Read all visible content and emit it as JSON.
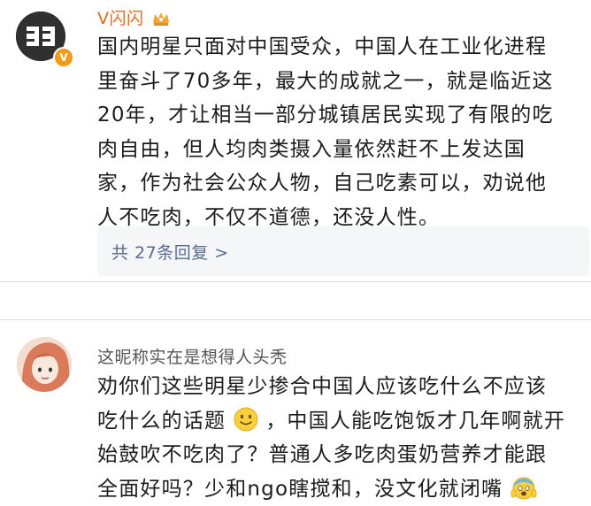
{
  "comments": [
    {
      "username": "V闪闪",
      "username_color": "#e8671c",
      "avatar_text": "ΞΞ",
      "verified_badge": "V",
      "crown_icon": "crown-icon",
      "lines": [
        "国内明星只面对中国受众，中国人在工业化进程",
        "里奋斗了70多年，最大的成就之一，就是临近这",
        "20年，才让相当一部分城镇居民实现了有限的吃",
        "肉自由，但人均肉类摄入量依然赶不上发达国",
        "家，作为社会公众人物，自己吃素可以，劝说他",
        "人不吃肉，不仅不道德，还没人性。"
      ],
      "reply_link": "共 27条回复 >"
    },
    {
      "username": "这昵称实在是想得人头秃",
      "username_color": "#555555",
      "line1": "劝你们这些明星少掺合中国人应该吃什么不应该",
      "line2_a": "吃什么的话题",
      "line2_b": "，中国人能吃饱饭才几年啊就开",
      "line3": "始鼓吹不吃肉了？普通人多吃肉蛋奶营养才能跟",
      "line4": "全面好吗？少和ngo瞎搅和，没文化就闭嘴",
      "emoji_1": "smile-emoji",
      "emoji_2": "scared-emoji"
    }
  ]
}
